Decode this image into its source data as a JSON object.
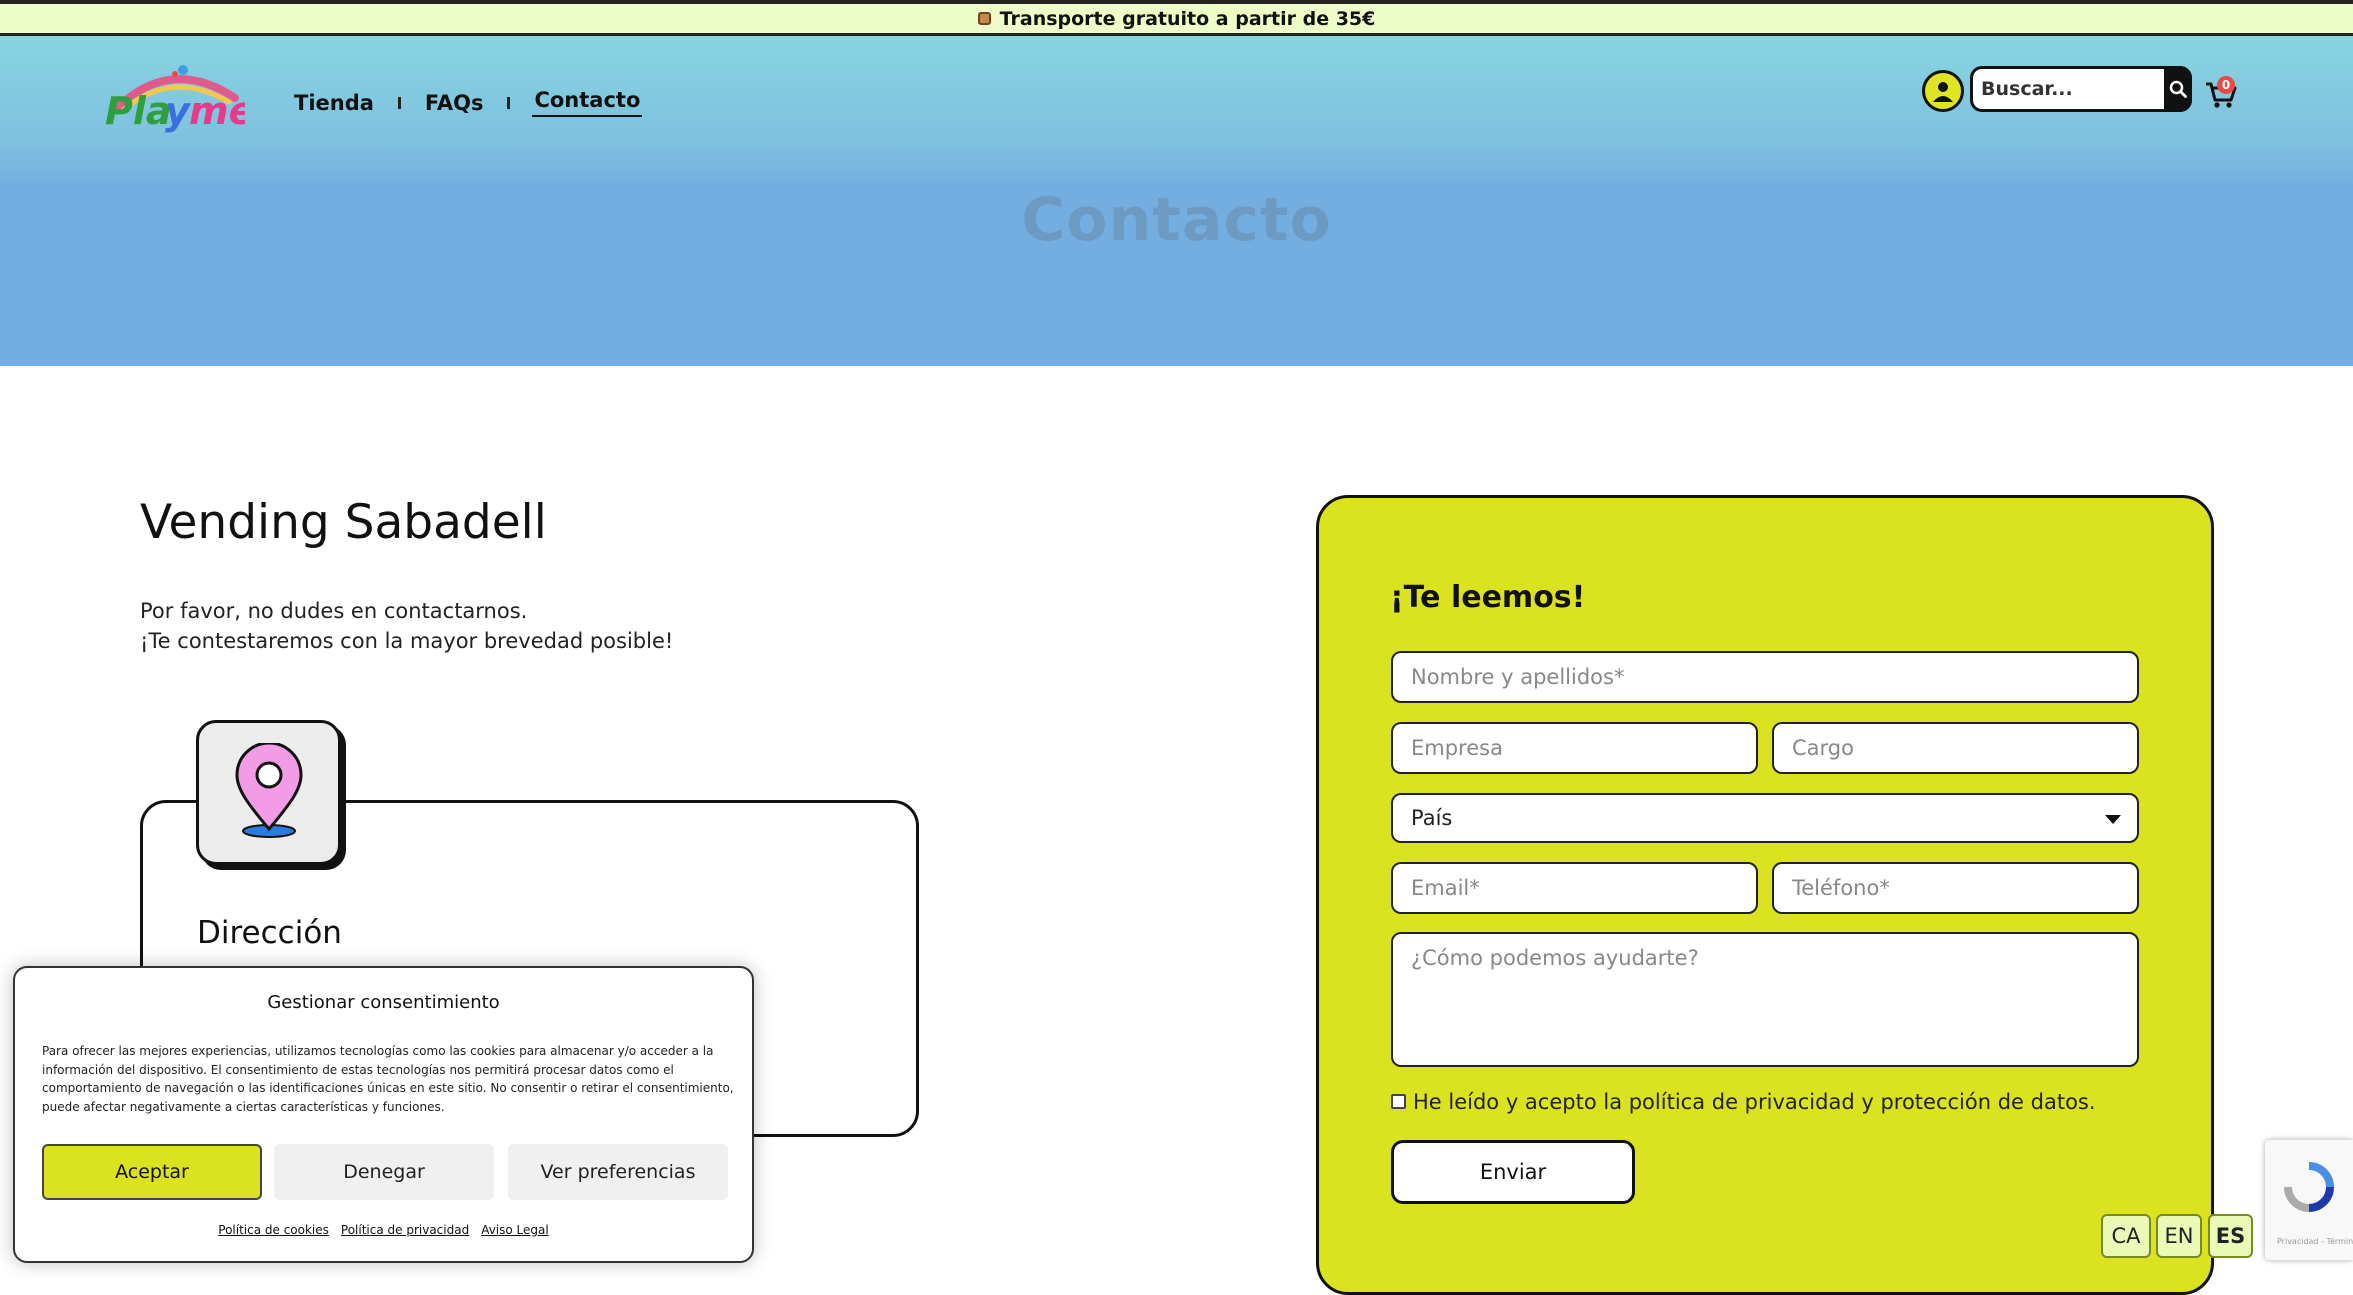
{
  "announcement": {
    "text": "Transporte gratuito a partir de 35€",
    "icon": "package-icon"
  },
  "header": {
    "logo_text": "Playme",
    "nav": [
      {
        "label": "Tienda"
      },
      {
        "label": "FAQs"
      },
      {
        "label": "Contacto",
        "active": true
      }
    ],
    "search_placeholder": "Buscar...",
    "cart_count": "0"
  },
  "hero": {
    "title": "Contacto"
  },
  "contact": {
    "title": "Vending Sabadell",
    "intro_line1": "Por favor, no dudes en contactarnos.",
    "intro_line2": "¡Te contestaremos con la mayor brevedad posible!",
    "address_title": "Dirección"
  },
  "form": {
    "title": "¡Te leemos!",
    "name_placeholder": "Nombre y apellidos*",
    "company_placeholder": "Empresa",
    "position_placeholder": "Cargo",
    "country_selected": "País",
    "email_placeholder": "Email*",
    "phone_placeholder": "Teléfono*",
    "message_placeholder": "¿Cómo podemos ayudarte?",
    "privacy_label": "He leído y acepto la política de privacidad y protección de datos.",
    "privacy_checked": false,
    "submit_label": "Enviar"
  },
  "languages": [
    "CA",
    "EN",
    "ES"
  ],
  "active_language": "ES",
  "recaptcha": {
    "footer": "Privacidad - Términos"
  },
  "consent": {
    "title": "Gestionar consentimiento",
    "body": "Para ofrecer las mejores experiencias, utilizamos tecnologías como las cookies para almacenar y/o acceder a la información del dispositivo. El consentimiento de estas tecnologías nos permitirá procesar datos como el comportamiento de navegación o las identificaciones únicas en este sitio. No consentir o retirar el consentimiento, puede afectar negativamente a ciertas características y funciones.",
    "accept_label": "Aceptar",
    "deny_label": "Denegar",
    "preferences_label": "Ver preferencias",
    "links": [
      "Política de cookies",
      "Política de privacidad",
      "Aviso Legal"
    ]
  },
  "colors": {
    "accent": "#dbe21f",
    "hero": "#74aee0",
    "topbar": "#eefcc8"
  }
}
